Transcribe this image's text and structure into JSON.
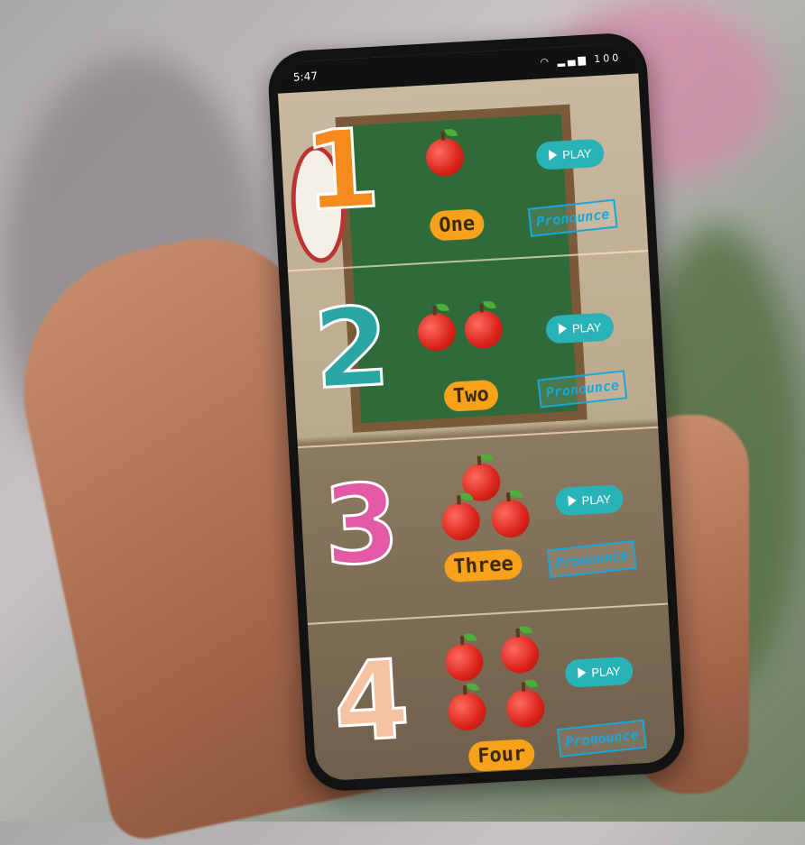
{
  "status_bar": {
    "time": "5:47",
    "indicators": "wifi signal battery-100",
    "battery_label": "100"
  },
  "numbers": [
    {
      "numeral": "1",
      "word": "One",
      "apples": 1,
      "color": "#f58a1f",
      "play_label": "PLAY",
      "pronounce_label": "Pronounce"
    },
    {
      "numeral": "2",
      "word": "Two",
      "apples": 2,
      "color": "#2aa7a4",
      "play_label": "PLAY",
      "pronounce_label": "Pronounce"
    },
    {
      "numeral": "3",
      "word": "Three",
      "apples": 3,
      "color": "#e25aa4",
      "play_label": "PLAY",
      "pronounce_label": "Pronounce"
    },
    {
      "numeral": "4",
      "word": "Four",
      "apples": 4,
      "color": "#f5c3a1",
      "play_label": "PLAY",
      "pronounce_label": "Pronounce"
    }
  ],
  "colors": {
    "play_button": "#2ab3b6",
    "pronounce_border": "#19a6d8",
    "word_badge": "#f7a21a",
    "chalkboard": "#2f6b3a"
  }
}
